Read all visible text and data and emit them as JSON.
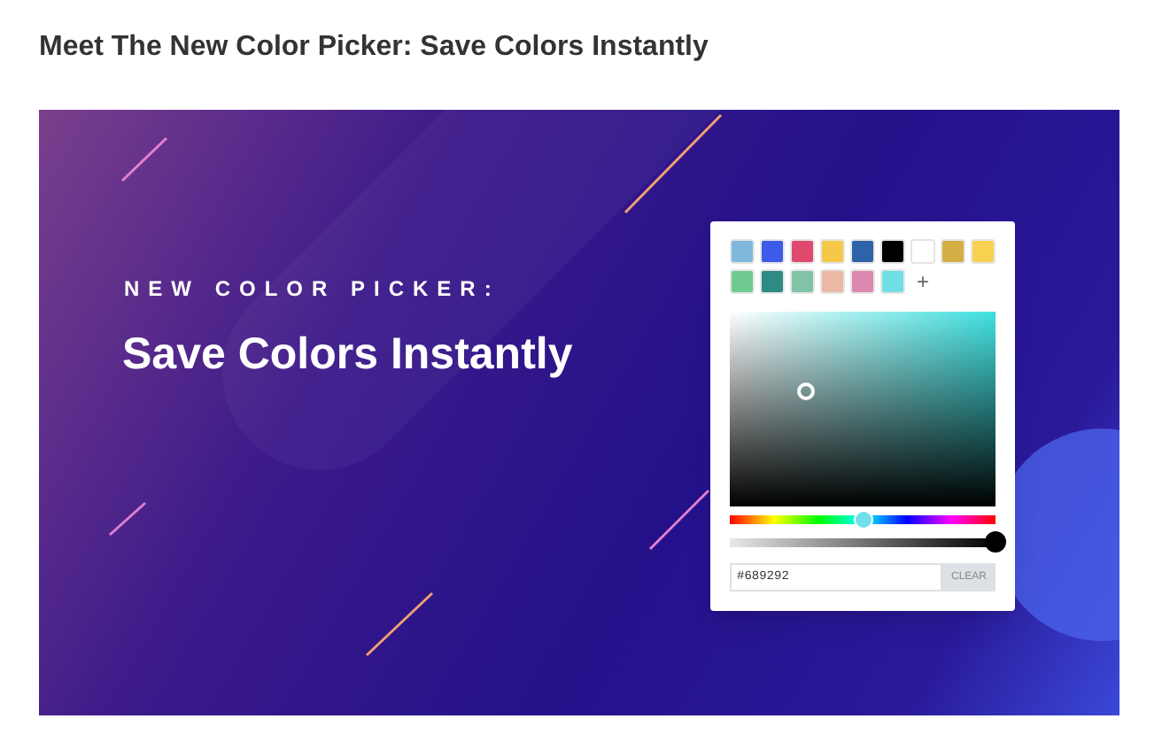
{
  "heading": "Meet The New Color Picker: Save Colors Instantly",
  "banner": {
    "eyebrow": "NEW COLOR PICKER:",
    "title": "Save Colors Instantly"
  },
  "picker": {
    "swatches": [
      {
        "color": "#7fb8dc"
      },
      {
        "color": "#3d5be8"
      },
      {
        "color": "#e0496e"
      },
      {
        "color": "#f5c84a"
      },
      {
        "color": "#2d63a8"
      },
      {
        "color": "#000000"
      },
      {
        "color": "#ffffff"
      },
      {
        "color": "#d4ae45"
      },
      {
        "color": "#f7d250"
      },
      {
        "color": "#6fcb8f"
      },
      {
        "color": "#2d8a84"
      },
      {
        "color": "#82c3a7"
      },
      {
        "color": "#ebb9a6"
      },
      {
        "color": "#dc8ab0"
      },
      {
        "color": "#6fdfe5"
      }
    ],
    "add_label": "+",
    "hue": {
      "level": 0.5
    },
    "alpha": {
      "level": 1
    },
    "hex_value": "#689292",
    "clear_button": "CLEAR"
  }
}
